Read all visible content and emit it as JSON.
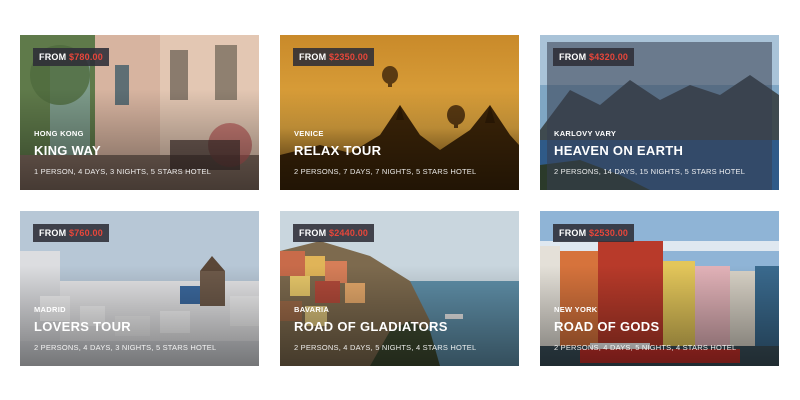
{
  "tours": [
    {
      "price_prefix": "FROM",
      "price": "$780.00",
      "city": "HONG KONG",
      "title": "KING WAY",
      "meta": "1 PERSON, 4 DAYS, 3 NIGHTS, 5 STARS HOTEL"
    },
    {
      "price_prefix": "FROM",
      "price": "$2350.00",
      "city": "VENICE",
      "title": "RELAX TOUR",
      "meta": "2 PERSONS, 7 DAYS, 7 NIGHTS, 5 STARS HOTEL"
    },
    {
      "price_prefix": "FROM",
      "price": "$4320.00",
      "city": "KARLOVY VARY",
      "title": "HEAVEN ON EARTH",
      "meta": "2 PERSONS, 14 DAYS, 15 NIGHTS, 5 STARS HOTEL"
    },
    {
      "price_prefix": "FROM",
      "price": "$760.00",
      "city": "MADRID",
      "title": "LOVERS TOUR",
      "meta": "2 PERSONS, 4 DAYS, 3 NIGHTS, 5 STARS HOTEL"
    },
    {
      "price_prefix": "FROM",
      "price": "$2440.00",
      "city": "BAVARIA",
      "title": "ROAD OF GLADIATORS",
      "meta": "2 PERSONS, 4 DAYS, 5 NIGHTS, 4 STARS HOTEL"
    },
    {
      "price_prefix": "FROM",
      "price": "$2530.00",
      "city": "NEW YORK",
      "title": "ROAD OF GODS",
      "meta": "2 PERSONS, 4 DAYS, 5 NIGHTS, 4 STARS HOTEL"
    }
  ],
  "colors": {
    "price_accent": "#e8463a",
    "price_bg": "#2d2d37"
  }
}
